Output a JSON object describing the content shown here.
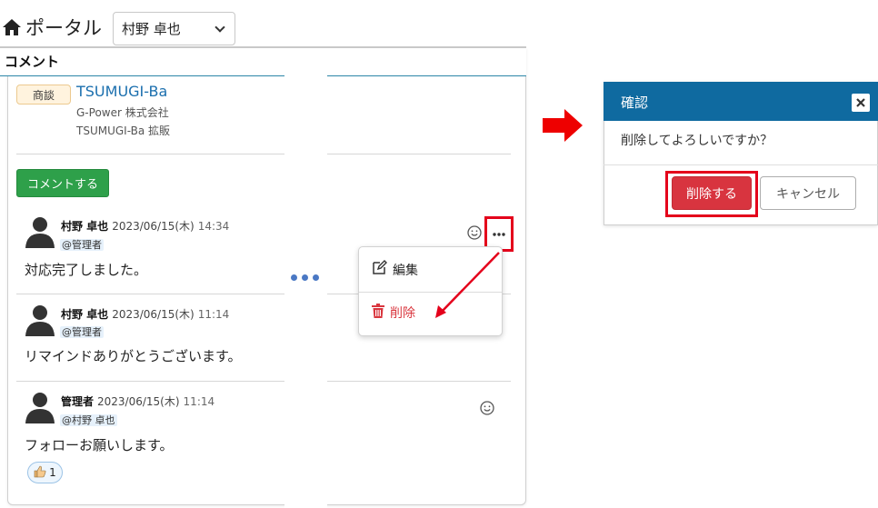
{
  "portal": {
    "title": "ポータル",
    "user_select_value": "村野 卓也"
  },
  "panel": {
    "header": "コメント"
  },
  "deal": {
    "badge": "商談",
    "name": "TSUMUGI-Ba",
    "company": "G-Power 株式会社",
    "project": "TSUMUGI-Ba 拡販"
  },
  "comment_button_label": "コメントする",
  "comments": [
    {
      "author": "村野 卓也",
      "date": "2023/06/15(木)",
      "time": "14:34",
      "mention": "@管理者",
      "body": "対応完了しました。"
    },
    {
      "author": "村野 卓也",
      "date": "2023/06/15(木)",
      "time": "11:14",
      "mention": "@管理者",
      "body": "リマインドありがとうございます。"
    },
    {
      "author": "管理者",
      "date": "2023/06/15(木)",
      "time": "11:14",
      "mention": "@村野 卓也",
      "body": "フォローお願いします。"
    }
  ],
  "reaction": {
    "count": "1"
  },
  "menu": {
    "edit_label": "編集",
    "delete_label": "削除"
  },
  "modal": {
    "title": "確認",
    "message": "削除してよろしいですか？",
    "delete_label": "削除する",
    "cancel_label": "キャンセル"
  },
  "colors": {
    "header_blue": "#0f6aa0",
    "danger_red": "#d8343f",
    "highlight_red": "#e4001b",
    "success_green": "#2ea04a",
    "link_blue": "#1b6fae"
  },
  "icons": [
    "home-icon",
    "chevron-down-icon",
    "user-avatar-icon",
    "smile-icon",
    "more-icon",
    "edit-icon",
    "trash-icon",
    "close-icon",
    "thumbs-up-icon",
    "arrow-right-icon"
  ]
}
